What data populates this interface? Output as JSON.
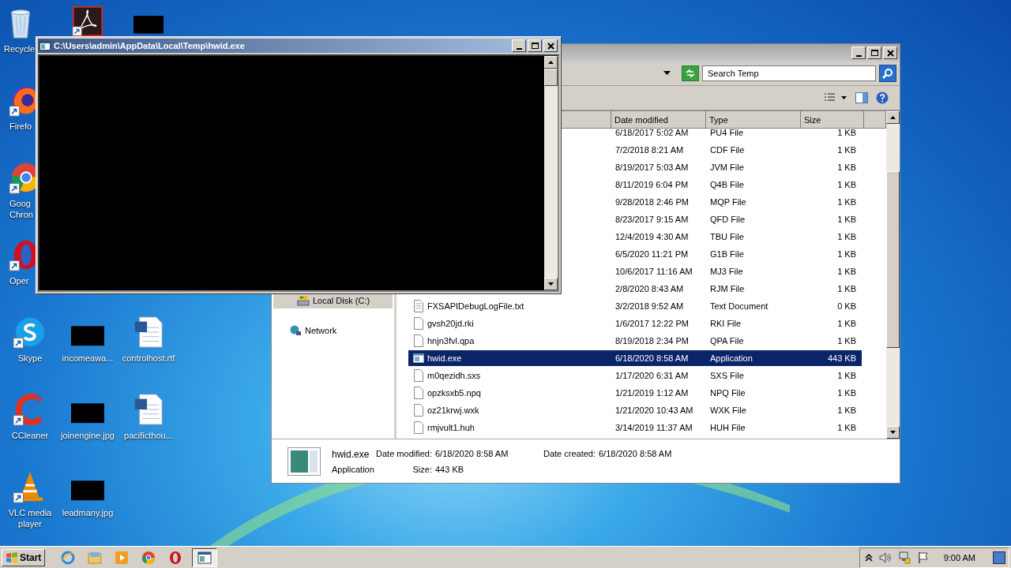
{
  "desktop": {
    "icons": [
      {
        "kind": "recycle",
        "label": "Recycle",
        "shortcut": false
      },
      {
        "kind": "acrobat",
        "shortcut": true
      },
      {
        "kind": "thumbnail",
        "shortcut": false
      },
      {
        "kind": "firefox",
        "label": "Firefo",
        "shortcut": true
      },
      {
        "kind": "chrome",
        "label": "Goog\nChron",
        "shortcut": true
      },
      {
        "kind": "opera",
        "label": "Oper",
        "shortcut": true
      },
      {
        "kind": "skype",
        "label": "Skype",
        "shortcut": true
      },
      {
        "kind": "thumbnail",
        "label": "incomeawa...",
        "shortcut": false
      },
      {
        "kind": "word",
        "label": "controlhost.rtf",
        "shortcut": false
      },
      {
        "kind": "ccleaner",
        "label": "CCleaner",
        "shortcut": true
      },
      {
        "kind": "thumbnail",
        "label": "joinengine.jpg",
        "shortcut": false
      },
      {
        "kind": "word",
        "label": "pacificthou...",
        "shortcut": false
      },
      {
        "kind": "vlc",
        "label": "VLC media player",
        "shortcut": true
      },
      {
        "kind": "thumbnail",
        "label": "leadmany.jpg",
        "shortcut": false
      }
    ]
  },
  "explorer_window": {
    "search": {
      "placeholder": "Search Temp"
    },
    "nav_items": [
      {
        "kind": "disk",
        "label": "Local Disk (C:)",
        "selected": true
      },
      {
        "kind": "network",
        "label": "Network",
        "selected": false
      }
    ],
    "columns": [
      "Date modified",
      "Type",
      "Size"
    ],
    "rows": [
      {
        "date": "6/18/2017 5:02 AM",
        "type": "PU4 File",
        "size": "1 KB",
        "selected": false
      },
      {
        "date": "7/2/2018 8:21 AM",
        "type": "CDF File",
        "size": "1 KB",
        "selected": false
      },
      {
        "date": "8/19/2017 5:03 AM",
        "type": "JVM File",
        "size": "1 KB",
        "selected": false
      },
      {
        "date": "8/11/2019 6:04 PM",
        "type": "Q4B File",
        "size": "1 KB",
        "selected": false
      },
      {
        "date": "9/28/2018 2:46 PM",
        "type": "MQP File",
        "size": "1 KB",
        "selected": false
      },
      {
        "date": "8/23/2017 9:15 AM",
        "type": "QFD File",
        "size": "1 KB",
        "selected": false
      },
      {
        "date": "12/4/2019 4:30 AM",
        "type": "TBU File",
        "size": "1 KB",
        "selected": false
      },
      {
        "date": "6/5/2020 11:21 PM",
        "type": "G1B File",
        "size": "1 KB",
        "selected": false
      },
      {
        "date": "10/6/2017 11:16 AM",
        "type": "MJ3 File",
        "size": "1 KB",
        "selected": false
      },
      {
        "date": "2/8/2020 8:43 AM",
        "type": "RJM File",
        "size": "1 KB",
        "selected": false
      },
      {
        "kind": "text",
        "name": "FXSAPIDebugLogFile.txt",
        "date": "3/2/2018 9:52 AM",
        "type": "Text Document",
        "size": "0 KB",
        "selected": false
      },
      {
        "kind": "file",
        "name": "gvsh20jd.rki",
        "date": "1/6/2017 12:22 PM",
        "type": "RKI File",
        "size": "1 KB",
        "selected": false
      },
      {
        "kind": "file",
        "name": "hnjn3fvl.qpa",
        "date": "8/19/2018 2:34 PM",
        "type": "QPA File",
        "size": "1 KB",
        "selected": false
      },
      {
        "kind": "app",
        "name": "hwid.exe",
        "date": "6/18/2020 8:58 AM",
        "type": "Application",
        "size": "443 KB",
        "selected": true
      },
      {
        "kind": "file",
        "name": "m0qezidh.sxs",
        "date": "1/17/2020 6:31 AM",
        "type": "SXS File",
        "size": "1 KB",
        "selected": false
      },
      {
        "kind": "file",
        "name": "opzksxb5.npq",
        "date": "1/21/2019 1:12 AM",
        "type": "NPQ File",
        "size": "1 KB",
        "selected": false
      },
      {
        "kind": "file",
        "name": "oz21krwj.wxk",
        "date": "1/21/2020 10:43 AM",
        "type": "WXK File",
        "size": "1 KB",
        "selected": false
      },
      {
        "kind": "file",
        "name": "rmjvult1.huh",
        "date": "3/14/2019 11:37 AM",
        "type": "HUH File",
        "size": "1 KB",
        "selected": false
      }
    ],
    "details": {
      "name": "hwid.exe",
      "type": "Application",
      "fields": [
        {
          "label": "Date modified:",
          "value": "6/18/2020 8:58 AM"
        },
        {
          "label": "Date created:",
          "value": "6/18/2020 8:58 AM"
        },
        {
          "label": "Size:",
          "value": "443 KB"
        }
      ]
    }
  },
  "console_window": {
    "title": "C:\\Users\\admin\\AppData\\Local\\Temp\\hwid.exe"
  },
  "taskbar": {
    "start": "Start",
    "clock": "9:00 AM",
    "apps": [
      {
        "kind": "ie",
        "active": false
      },
      {
        "kind": "folder",
        "active": false
      },
      {
        "kind": "media",
        "active": false
      },
      {
        "kind": "chrome",
        "active": false
      },
      {
        "kind": "opera",
        "active": false
      },
      {
        "kind": "console",
        "active": true
      }
    ]
  }
}
